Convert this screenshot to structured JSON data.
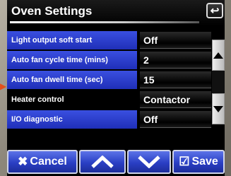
{
  "title": "Oven Settings",
  "back_icon": "back-arrow-icon",
  "settings": [
    {
      "label": "Light output soft start",
      "value": "Off"
    },
    {
      "label": "Auto fan cycle time (mins)",
      "value": "2"
    },
    {
      "label": "Auto fan dwell time (sec)",
      "value": "15"
    },
    {
      "label": "Heater control",
      "value": "Contactor"
    },
    {
      "label": "I/O diagnostic",
      "value": "Off"
    }
  ],
  "footer": {
    "cancel_label": "Cancel",
    "save_label": "Save"
  },
  "colors": {
    "accent_blue": "#2a3fc4",
    "pointer": "#e3501c"
  }
}
